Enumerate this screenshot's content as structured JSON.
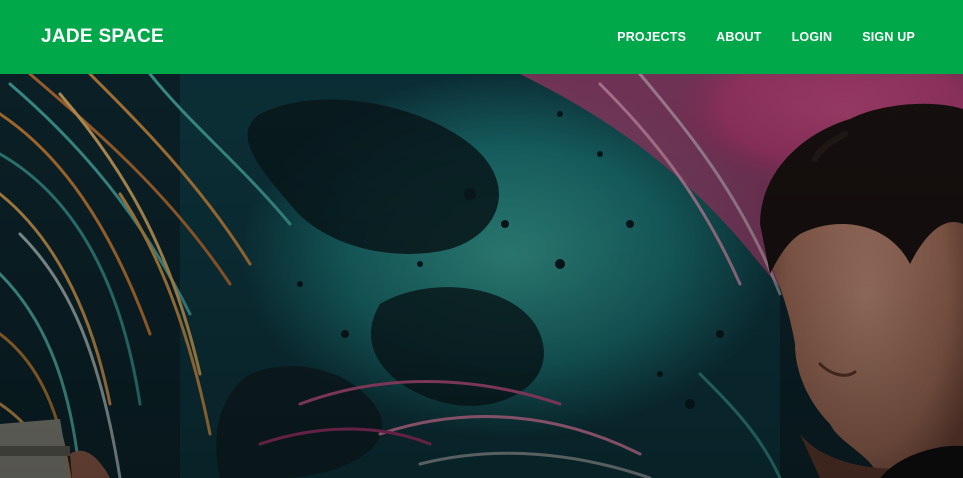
{
  "nav": {
    "brand": "JADE SPACE",
    "links": [
      "PROJECTS",
      "ABOUT",
      "LOGIN",
      "SIGN UP"
    ]
  },
  "hero": {
    "image": "graffiti-mural-with-artist",
    "overlay": "dark"
  },
  "colors": {
    "navbar": "#00a84a",
    "nav_text": "#ffffff",
    "mural_teal": "#1f8f8a",
    "mural_magenta": "#b03a78",
    "mural_orange": "#c98a3a"
  }
}
